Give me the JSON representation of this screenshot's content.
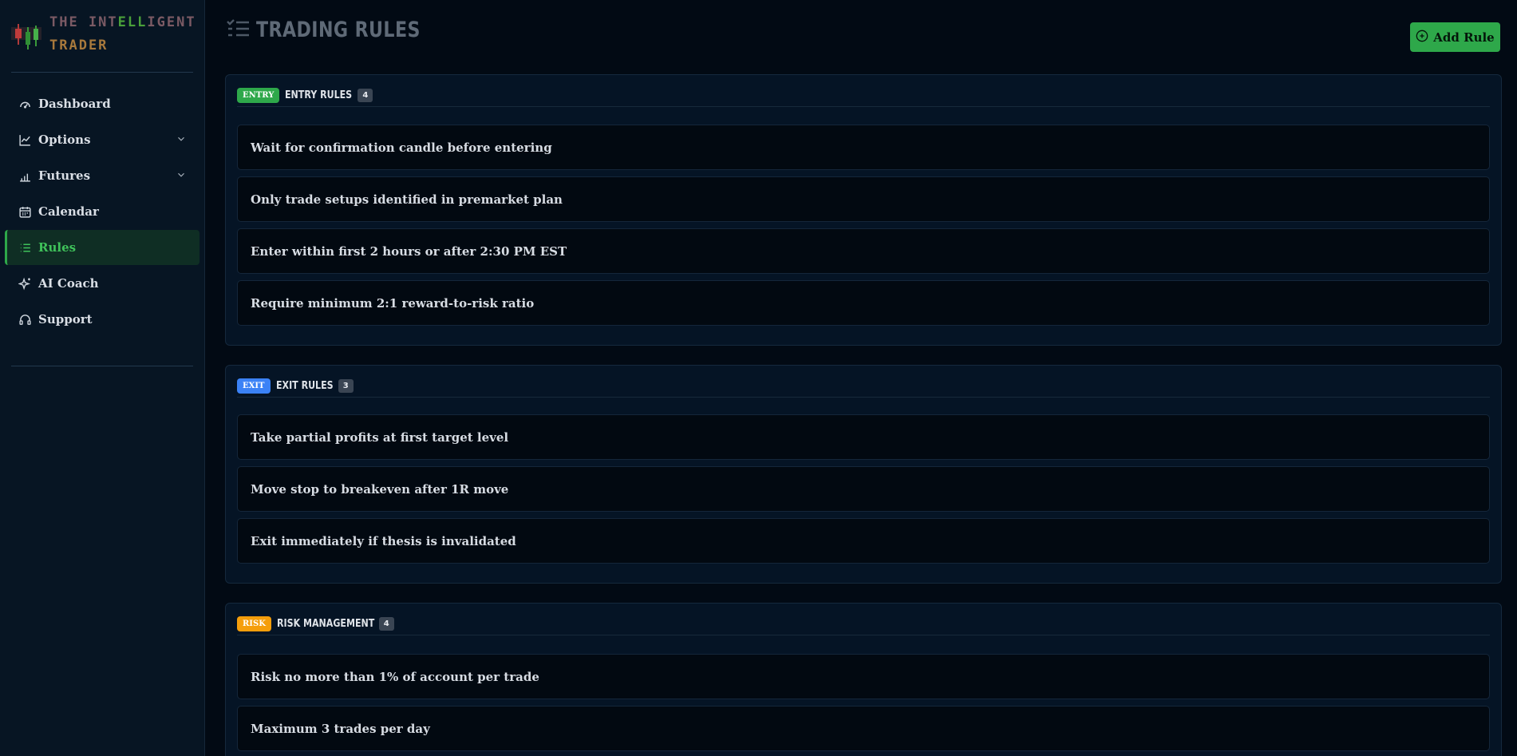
{
  "brand": {
    "name_line1_a": "THE INT",
    "name_line1_b": "ELL",
    "name_line1_c": "IGENT",
    "name_line2": "TRADER"
  },
  "nav": {
    "items": [
      {
        "label": "Dashboard",
        "icon": "gauge-icon"
      },
      {
        "label": "Options",
        "icon": "line-chart-icon",
        "has_chevron": true
      },
      {
        "label": "Futures",
        "icon": "bar-chart-icon",
        "has_chevron": true
      },
      {
        "label": "Calendar",
        "icon": "calendar-icon"
      },
      {
        "label": "Rules",
        "icon": "list-icon",
        "active": true
      },
      {
        "label": "AI Coach",
        "icon": "sparkles-icon"
      },
      {
        "label": "Support",
        "icon": "headset-icon"
      }
    ]
  },
  "header": {
    "title": "TRADING RULES",
    "add_button": "Add Rule"
  },
  "sections": [
    {
      "badge": "ENTRY",
      "title": "ENTRY RULES",
      "count": "4",
      "rules": [
        "Wait for confirmation candle before entering",
        "Only trade setups identified in premarket plan",
        "Enter within first 2 hours or after 2:30 PM EST",
        "Require minimum 2:1 reward-to-risk ratio"
      ]
    },
    {
      "badge": "EXIT",
      "title": "EXIT RULES",
      "count": "3",
      "rules": [
        "Take partial profits at first target level",
        "Move stop to breakeven after 1R move",
        "Exit immediately if thesis is invalidated"
      ]
    },
    {
      "badge": "RISK",
      "title": "RISK MANAGEMENT",
      "count": "4",
      "rules": [
        "Risk no more than 1% of account per trade",
        "Maximum 3 trades per day"
      ]
    }
  ],
  "colors": {
    "accent_green": "#2ea84a",
    "entry_badge": "#2ea84a",
    "exit_badge": "#3b82f6",
    "risk_badge": "#f59e0b"
  }
}
